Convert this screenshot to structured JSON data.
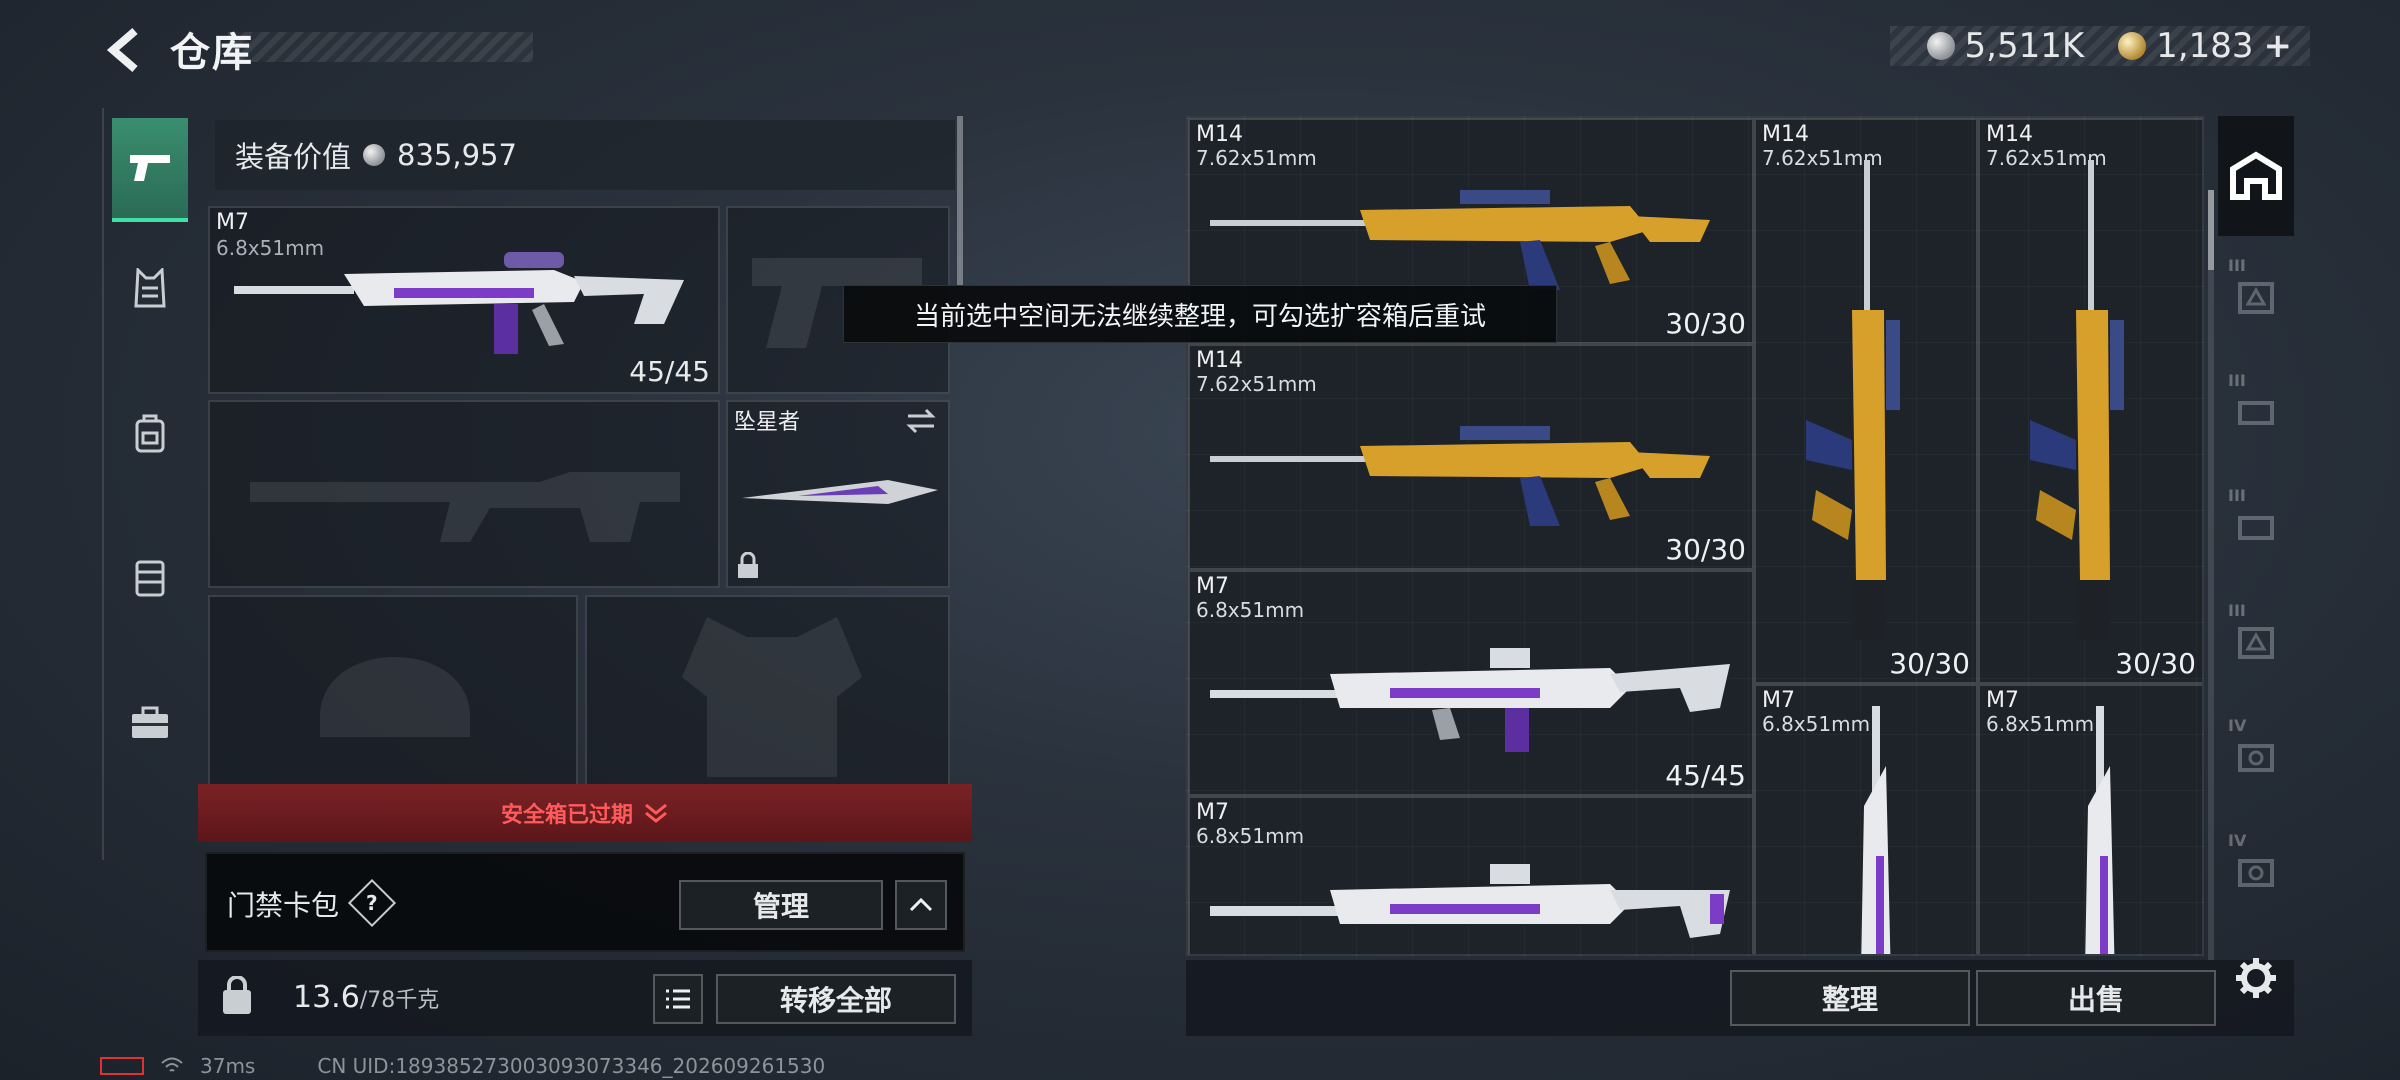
{
  "header": {
    "title": "仓库",
    "currency_silver": "5,511K",
    "currency_gold": "1,183",
    "currency_plus": "+"
  },
  "sidebar": {
    "tabs": [
      {
        "icon": "pistol-icon",
        "active": true
      },
      {
        "icon": "vest-icon",
        "active": false
      },
      {
        "icon": "backpack-icon",
        "active": false
      },
      {
        "icon": "armor-plate-icon",
        "active": false
      },
      {
        "icon": "briefcase-icon",
        "active": false
      }
    ]
  },
  "loadout": {
    "equip_value_label": "装备价值",
    "equip_value": "835,957",
    "primary": {
      "name": "M7",
      "caliber": "6.8x51mm",
      "ammo": "45/45"
    },
    "melee": {
      "name": "坠星者"
    },
    "alert": "安全箱已过期",
    "card_label": "门禁卡包",
    "help": "?",
    "manage": "管理",
    "weight": "13.6",
    "weight_max": "/78千克",
    "transfer_all": "转移全部"
  },
  "toast": "当前选中空间无法继续整理，可勾选扩容箱后重试",
  "stash": {
    "items": [
      {
        "name": "M14",
        "caliber": "7.62x51mm",
        "ammo": "30/30"
      },
      {
        "name": "M14",
        "caliber": "7.62x51mm",
        "ammo": "30/30"
      },
      {
        "name": "M14",
        "caliber": "7.62x51mm",
        "ammo": "30/30"
      },
      {
        "name": "M14",
        "caliber": "7.62x51mm",
        "ammo": "30/30"
      },
      {
        "name": "M7",
        "caliber": "6.8x51mm",
        "ammo": "45/45"
      },
      {
        "name": "M7",
        "caliber": "6.8x51mm",
        "ammo": ""
      },
      {
        "name": "M7",
        "caliber": "6.8x51mm",
        "ammo": ""
      },
      {
        "name": "M7",
        "caliber": "6.8x51mm",
        "ammo": ""
      }
    ],
    "sort_button": "整理",
    "sell_button": "出售"
  },
  "right_rail": {
    "tiers": [
      "III",
      "III",
      "III",
      "III",
      "IV",
      "IV"
    ]
  },
  "status": {
    "ping": "37ms",
    "uid": "CN UID:1893852730030930733​46_202609261530"
  },
  "colors": {
    "accent_green": "#3fe0a6",
    "gold_skin": "#d7a02a",
    "alert_red": "#ff5b5b"
  }
}
